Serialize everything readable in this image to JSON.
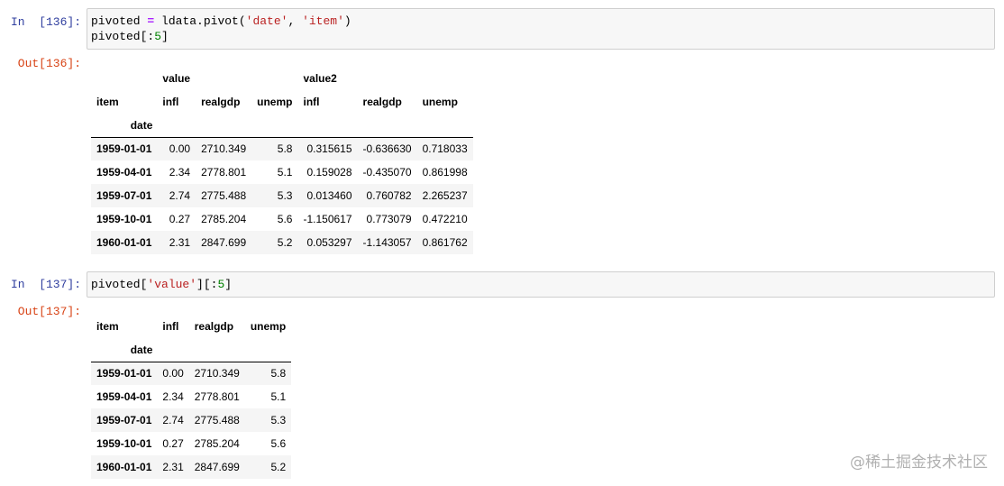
{
  "cell1": {
    "in_prompt": "In  [136]:",
    "out_prompt": "Out[136]:",
    "code_line1": {
      "pre": "pivoted ",
      "op": "=",
      "mid": " ldata.pivot(",
      "str1": "'date'",
      "sep": ", ",
      "str2": "'item'",
      "post": ")"
    },
    "code_line2": {
      "pre": "pivoted[:",
      "num": "5",
      "post": "]"
    },
    "table": {
      "top_headers": [
        "",
        "value",
        "",
        "",
        "value2",
        "",
        ""
      ],
      "columns": [
        "item",
        "infl",
        "realgdp",
        "unemp",
        "infl",
        "realgdp",
        "unemp"
      ],
      "index_name": "date",
      "rows": [
        [
          "1959-01-01",
          "0.00",
          "2710.349",
          "5.8",
          "0.315615",
          "-0.636630",
          "0.718033"
        ],
        [
          "1959-04-01",
          "2.34",
          "2778.801",
          "5.1",
          "0.159028",
          "-0.435070",
          "0.861998"
        ],
        [
          "1959-07-01",
          "2.74",
          "2775.488",
          "5.3",
          "0.013460",
          "0.760782",
          "2.265237"
        ],
        [
          "1959-10-01",
          "0.27",
          "2785.204",
          "5.6",
          "-1.150617",
          "0.773079",
          "0.472210"
        ],
        [
          "1960-01-01",
          "2.31",
          "2847.699",
          "5.2",
          "0.053297",
          "-1.143057",
          "0.861762"
        ]
      ]
    }
  },
  "cell2": {
    "in_prompt": "In  [137]:",
    "out_prompt": "Out[137]:",
    "code_line1": {
      "pre": "pivoted[",
      "str": "'value'",
      "post": "][:",
      "num": "5",
      "end": "]"
    },
    "table": {
      "columns": [
        "item",
        "infl",
        "realgdp",
        "unemp"
      ],
      "index_name": "date",
      "rows": [
        [
          "1959-01-01",
          "0.00",
          "2710.349",
          "5.8"
        ],
        [
          "1959-04-01",
          "2.34",
          "2778.801",
          "5.1"
        ],
        [
          "1959-07-01",
          "2.74",
          "2775.488",
          "5.3"
        ],
        [
          "1959-10-01",
          "0.27",
          "2785.204",
          "5.6"
        ],
        [
          "1960-01-01",
          "2.31",
          "2847.699",
          "5.2"
        ]
      ]
    }
  },
  "watermark": "@稀土掘金技术社区"
}
